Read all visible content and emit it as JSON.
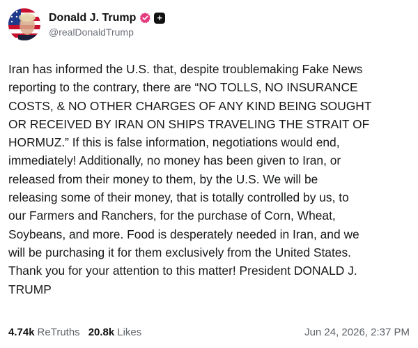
{
  "author": {
    "display_name": "Donald J. Trump",
    "handle": "@realDonaldTrump",
    "badge_icon": "plus-icon",
    "verified_icon": "verified-badge-icon",
    "verified_color": "#e33b7e"
  },
  "post": {
    "text": "Iran has informed the U.S. that, despite troublemaking Fake News\nreporting to the contrary, there are “NO TOLLS, NO INSURANCE\nCOSTS, & NO OTHER CHARGES OF ANY KIND BEING SOUGHT\nOR RECEIVED BY IRAN ON SHIPS TRAVELING THE STRAIT OF\nHORMUZ.” If this is false information, negotiations would end,\nimmediately! Additionally, no money has been given to Iran, or\nreleased from their money to them, by the U.S. We will be\nreleasing some of their money, that is totally controlled by us, to\nour Farmers and Ranchers, for the purchase of Corn, Wheat,\nSoybeans, and more. Food is desperately needed in Iran, and we\nwill be purchasing it for them exclusively from the United States.\nThank you for your attention to this matter! President DONALD J.\nTRUMP"
  },
  "stats": {
    "retruths_count": "4.74k",
    "retruths_label": "ReTruths",
    "likes_count": "20.8k",
    "likes_label": "Likes"
  },
  "timestamp": "Jun 24, 2026, 2:37 PM"
}
